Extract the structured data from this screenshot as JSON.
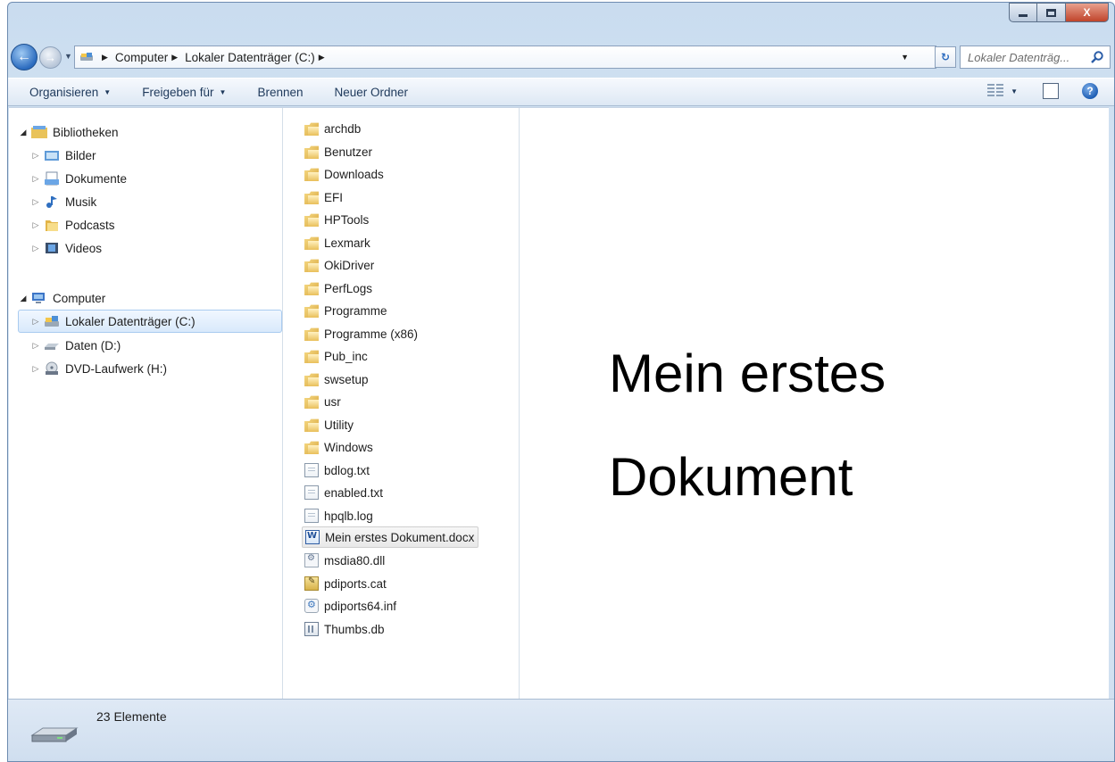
{
  "window": {
    "caption": {
      "minimize_icon": "minimize-icon",
      "maximize_icon": "maximize-icon",
      "close_label": "X"
    }
  },
  "address": {
    "crumbs": [
      "Computer",
      "Lokaler Datenträger (C:)"
    ],
    "search_placeholder": "Lokaler Datenträg..."
  },
  "toolbar": {
    "items": [
      "Organisieren",
      "Freigeben für",
      "Brennen",
      "Neuer Ordner"
    ]
  },
  "nav": {
    "items": [
      {
        "label": "Bibliotheken",
        "icon": "library-icon"
      },
      {
        "label": "Bilder",
        "icon": "pictures-icon"
      },
      {
        "label": "Dokumente",
        "icon": "documents-icon"
      },
      {
        "label": "Musik",
        "icon": "music-icon"
      },
      {
        "label": "Podcasts",
        "icon": "folder-icon"
      },
      {
        "label": "Videos",
        "icon": "videos-icon"
      },
      {
        "label": "Computer",
        "icon": "computer-icon"
      },
      {
        "label": "Lokaler Datenträger (C:)",
        "icon": "drive-icon"
      },
      {
        "label": "Daten (D:)",
        "icon": "drive-icon"
      },
      {
        "label": "DVD-Laufwerk (H:)",
        "icon": "dvd-icon"
      }
    ]
  },
  "files": [
    {
      "name": "archdb",
      "icon": "folder-icon"
    },
    {
      "name": "Benutzer",
      "icon": "folder-icon"
    },
    {
      "name": "Downloads",
      "icon": "folder-icon"
    },
    {
      "name": "EFI",
      "icon": "folder-icon"
    },
    {
      "name": "HPTools",
      "icon": "folder-icon"
    },
    {
      "name": "Lexmark",
      "icon": "folder-icon"
    },
    {
      "name": "OkiDriver",
      "icon": "folder-icon"
    },
    {
      "name": "PerfLogs",
      "icon": "folder-icon"
    },
    {
      "name": "Programme",
      "icon": "folder-icon"
    },
    {
      "name": "Programme (x86)",
      "icon": "folder-icon"
    },
    {
      "name": "Pub_inc",
      "icon": "folder-icon"
    },
    {
      "name": "swsetup",
      "icon": "folder-icon"
    },
    {
      "name": "usr",
      "icon": "folder-icon"
    },
    {
      "name": "Utility",
      "icon": "folder-icon"
    },
    {
      "name": "Windows",
      "icon": "folder-icon"
    },
    {
      "name": "bdlog.txt",
      "icon": "text-file-icon"
    },
    {
      "name": "enabled.txt",
      "icon": "text-file-icon"
    },
    {
      "name": "hpqlb.log",
      "icon": "text-file-icon"
    },
    {
      "name": "Mein erstes Dokument.docx",
      "icon": "word-document-icon"
    },
    {
      "name": "msdia80.dll",
      "icon": "dll-file-icon"
    },
    {
      "name": "pdiports.cat",
      "icon": "catalog-file-icon"
    },
    {
      "name": "pdiports64.inf",
      "icon": "setup-info-file-icon"
    },
    {
      "name": "Thumbs.db",
      "icon": "database-file-icon"
    }
  ],
  "preview": {
    "line1": "Mein erstes",
    "line2": "Dokument"
  },
  "status": {
    "count_text": "23 Elemente"
  },
  "colors": {
    "accent": "#2c6cbf",
    "selection": "#d9e9fb"
  }
}
